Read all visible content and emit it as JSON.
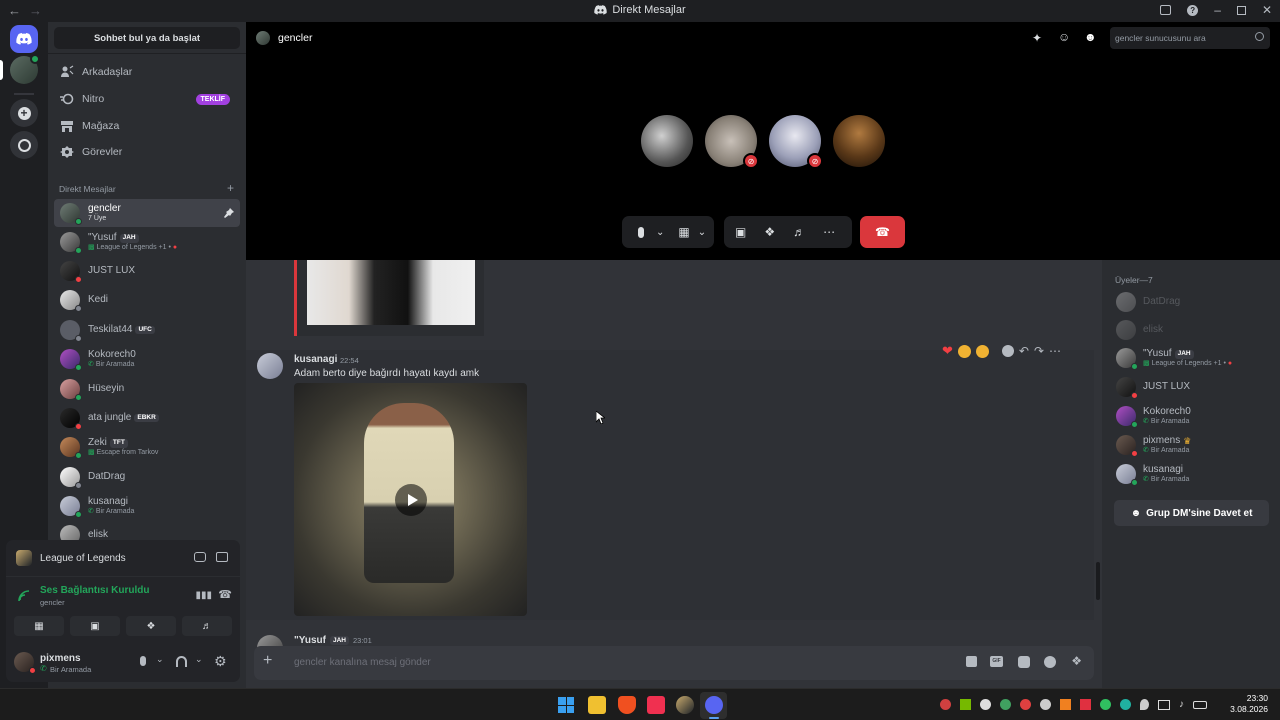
{
  "window": {
    "title": "Direkt Mesajlar"
  },
  "sidebar": {
    "search_label": "Sohbet bul ya da başlat",
    "nav": [
      {
        "label": "Arkadaşlar"
      },
      {
        "label": "Nitro",
        "badge": "TEKLİF"
      },
      {
        "label": "Mağaza"
      },
      {
        "label": "Görevler"
      }
    ],
    "dm_header": "Direkt Mesajlar",
    "dm_add": "+",
    "dms": [
      {
        "name": "gencler",
        "sub": "7 Üye",
        "active": true
      },
      {
        "name": "\"Yusuf",
        "tag": "JAH",
        "sub": "League of Legends +1 •",
        "status": "online"
      },
      {
        "name": "JUST LUX",
        "status": "dnd"
      },
      {
        "name": "Kedi",
        "status": "offline"
      },
      {
        "name": "Teskilat44",
        "tag": "UFC",
        "status": "offline"
      },
      {
        "name": "Kokorech0",
        "sub": "Bir Aramada",
        "status": "online"
      },
      {
        "name": "Hüseyin",
        "status": "online"
      },
      {
        "name": "ata jungle",
        "tag": "EBKR",
        "status": "dnd"
      },
      {
        "name": "Zeki",
        "tag": "TFT",
        "sub": "Escape from Tarkov",
        "status": "online"
      },
      {
        "name": "DatDrag",
        "status": "offline"
      },
      {
        "name": "kusanagi",
        "sub": "Bir Aramada",
        "status": "online"
      },
      {
        "name": "elisk",
        "status": "offline"
      }
    ]
  },
  "panel": {
    "activity": "League of Legends",
    "voice_status": "Ses Bağlantısı Kuruldu",
    "voice_channel": "gencler",
    "user_name": "pixmens",
    "user_status": "Bir Aramada"
  },
  "topbar": {
    "channel": "gencler",
    "search_placeholder": "gencler sunucusunu ara"
  },
  "messages": [
    {
      "author": "kusanagi",
      "time": "22:54",
      "text": "Adam berto diye bağırdı hayatı kaydı amk"
    },
    {
      "author": "\"Yusuf",
      "tag": "JAH",
      "time": "23:01"
    }
  ],
  "composer": {
    "placeholder": "gencler kanalına mesaj gönder"
  },
  "members": {
    "header": "Üyeler—7",
    "list": [
      {
        "name": "DatDrag",
        "dim": true
      },
      {
        "name": "elisk",
        "dim": true
      },
      {
        "name": "\"Yusuf",
        "tag": "JAH",
        "sub": "League of Legends +1 •",
        "status": "online"
      },
      {
        "name": "JUST LUX",
        "status": "dnd"
      },
      {
        "name": "Kokorech0",
        "sub": "Bir Aramada",
        "status": "online"
      },
      {
        "name": "pixmens",
        "sub": "Bir Aramada",
        "status": "dnd"
      },
      {
        "name": "kusanagi",
        "sub": "Bir Aramada",
        "status": "online"
      }
    ],
    "invite_label": "Grup DM'sine Davet et"
  },
  "taskbar": {
    "time": "23:30",
    "date": "3.08.2026"
  },
  "colors": {
    "accent": "#5865f2",
    "online": "#23a55a",
    "dnd": "#f23f43",
    "offline": "#80848e",
    "hangup": "#da373c",
    "nitro": "#a240e0"
  }
}
